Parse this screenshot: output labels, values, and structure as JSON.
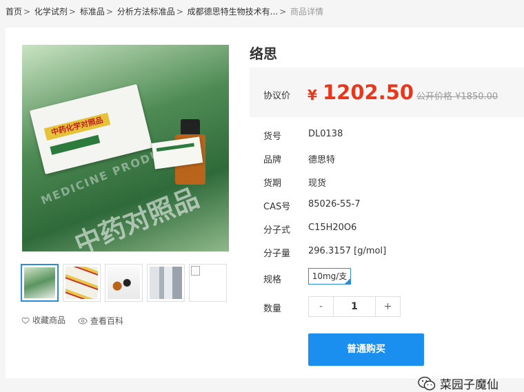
{
  "breadcrumb": {
    "items": [
      "首页",
      "化学试剂",
      "标准品",
      "分析方法标准品",
      "成都德思特生物技术有..."
    ],
    "current": "商品详情",
    "separator": ">"
  },
  "gallery": {
    "main_image_text": "中药对照品",
    "main_image_text2": "MEDICINE PRODUCTS",
    "box_band_text": "中药化学对照品",
    "thumbnails": [
      "thumb-1",
      "thumb-2",
      "thumb-3",
      "thumb-4",
      "thumb-5"
    ]
  },
  "actions": {
    "favorite_label": "收藏商品",
    "wiki_label": "查看百科"
  },
  "product": {
    "title": "络思",
    "price_label": "协议价",
    "currency": "¥",
    "price": "1202.50",
    "public_price": "公开价格 ¥1850.00",
    "attributes": [
      {
        "label": "货号",
        "value": "DL0138"
      },
      {
        "label": "品牌",
        "value": "德思特"
      },
      {
        "label": "货期",
        "value": "现货"
      },
      {
        "label": "CAS号",
        "value": "85026-55-7"
      },
      {
        "label": "分子式",
        "value": "C15H20O6"
      },
      {
        "label": "分子量",
        "value": "296.3157 [g/mol]"
      }
    ],
    "spec_label": "规格",
    "spec_option": "10mg/支",
    "qty_label": "数量",
    "qty_minus": "-",
    "qty_value": "1",
    "qty_plus": "+",
    "buy_label": "普通购买"
  },
  "watermark": {
    "text": "菜园子魔仙",
    "icon": "wechat-icon"
  },
  "colors": {
    "accent": "#1a8ff0",
    "price": "#e8381c"
  }
}
